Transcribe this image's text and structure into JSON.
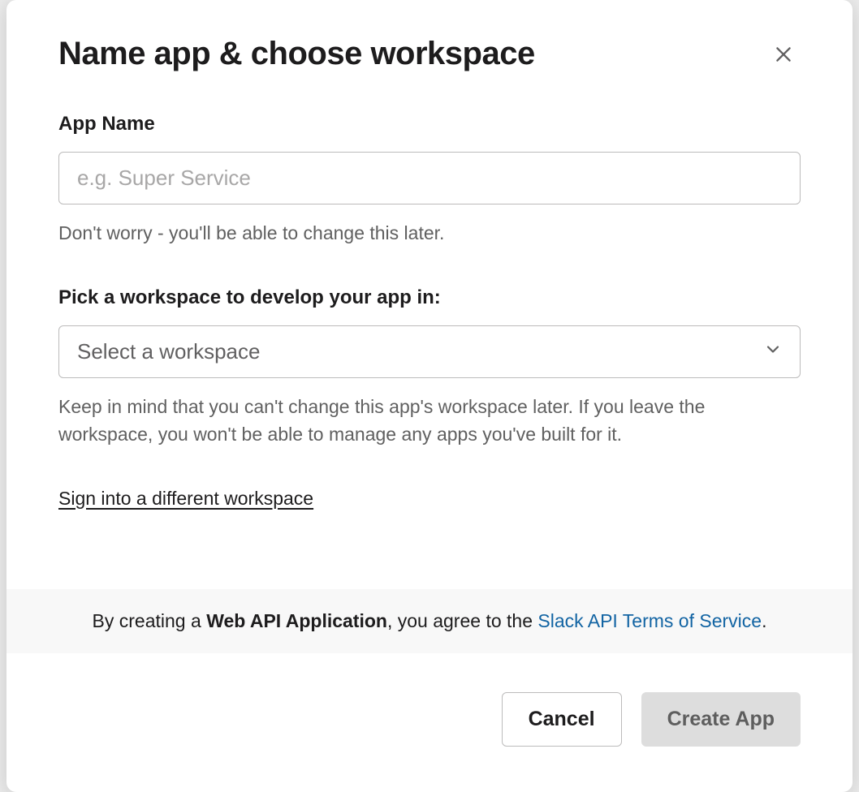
{
  "modal": {
    "title": "Name app & choose workspace",
    "appName": {
      "label": "App Name",
      "placeholder": "e.g. Super Service",
      "value": "",
      "help": "Don't worry - you'll be able to change this later."
    },
    "workspace": {
      "label": "Pick a workspace to develop your app in:",
      "selected": "Select a workspace",
      "help": "Keep in mind that you can't change this app's workspace later. If you leave the workspace, you won't be able to manage any apps you've built for it."
    },
    "signInLink": "Sign into a different workspace",
    "terms": {
      "prefix": "By creating a ",
      "bold": "Web API Application",
      "mid": ", you agree to the ",
      "link": "Slack API Terms of Service",
      "suffix": "."
    },
    "buttons": {
      "cancel": "Cancel",
      "create": "Create App"
    }
  }
}
